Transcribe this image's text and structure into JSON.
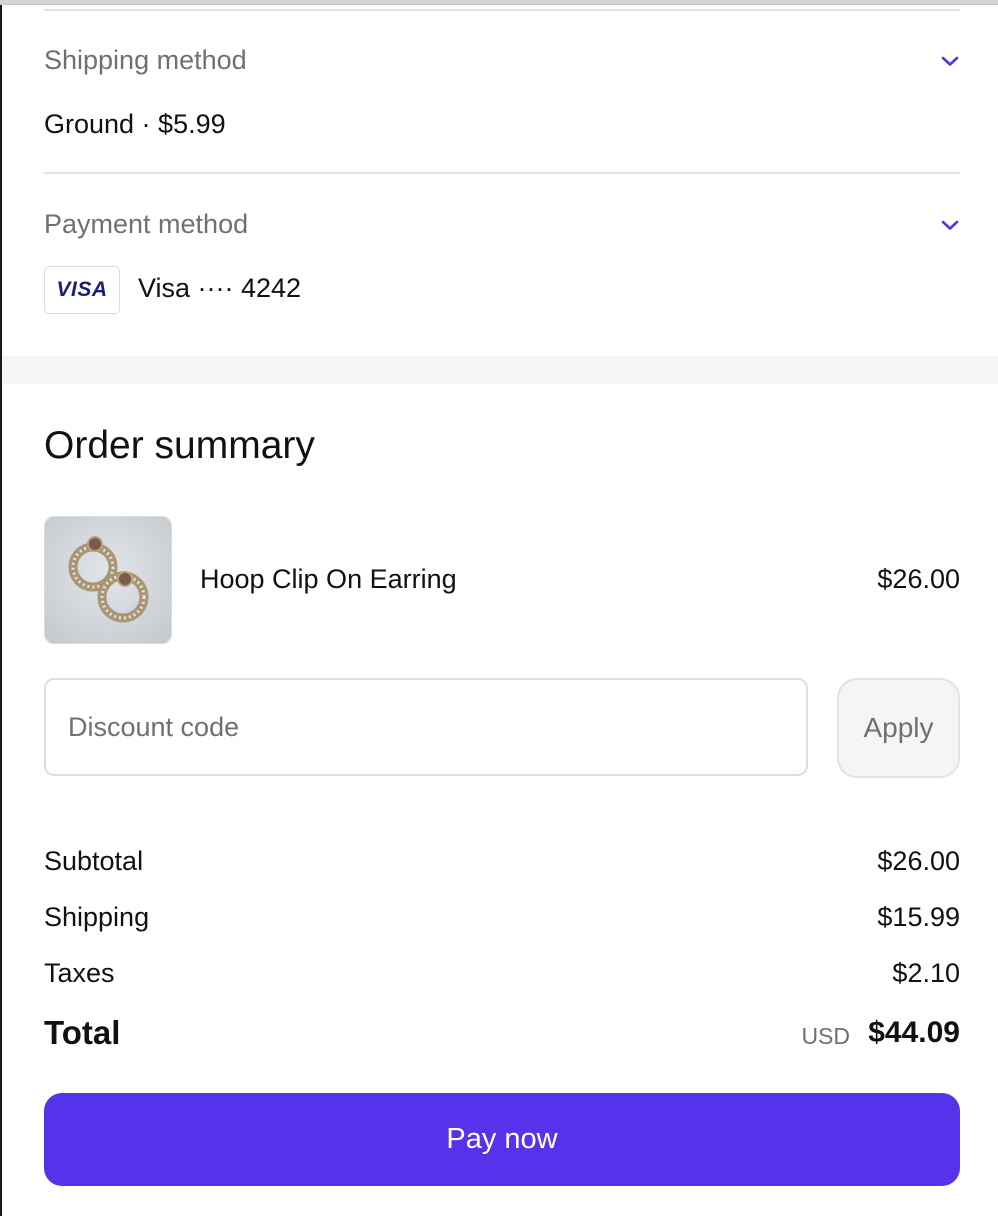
{
  "shipping": {
    "label": "Shipping method",
    "value": "Ground · $5.99"
  },
  "payment": {
    "label": "Payment method",
    "card_brand": "VISA",
    "value": "Visa ···· 4242"
  },
  "summary": {
    "title": "Order summary",
    "item": {
      "name": "Hoop Clip On Earring",
      "price": "$26.00"
    },
    "discount": {
      "placeholder": "Discount code",
      "apply_label": "Apply"
    },
    "lines": {
      "subtotal_label": "Subtotal",
      "subtotal_value": "$26.00",
      "shipping_label": "Shipping",
      "shipping_value": "$15.99",
      "taxes_label": "Taxes",
      "taxes_value": "$2.10"
    },
    "total": {
      "label": "Total",
      "currency": "USD",
      "value": "$44.09"
    },
    "pay_label": "Pay now"
  },
  "colors": {
    "accent": "#5433eb",
    "chevron": "#5433eb",
    "visa_blue": "#1a1f71",
    "muted_text": "#707070",
    "divider": "#e3e3e3",
    "band": "#f5f5f5"
  },
  "icons": {
    "shipping_toggle": "chevron-down-icon",
    "payment_toggle": "chevron-down-icon",
    "card": "visa-logo"
  }
}
